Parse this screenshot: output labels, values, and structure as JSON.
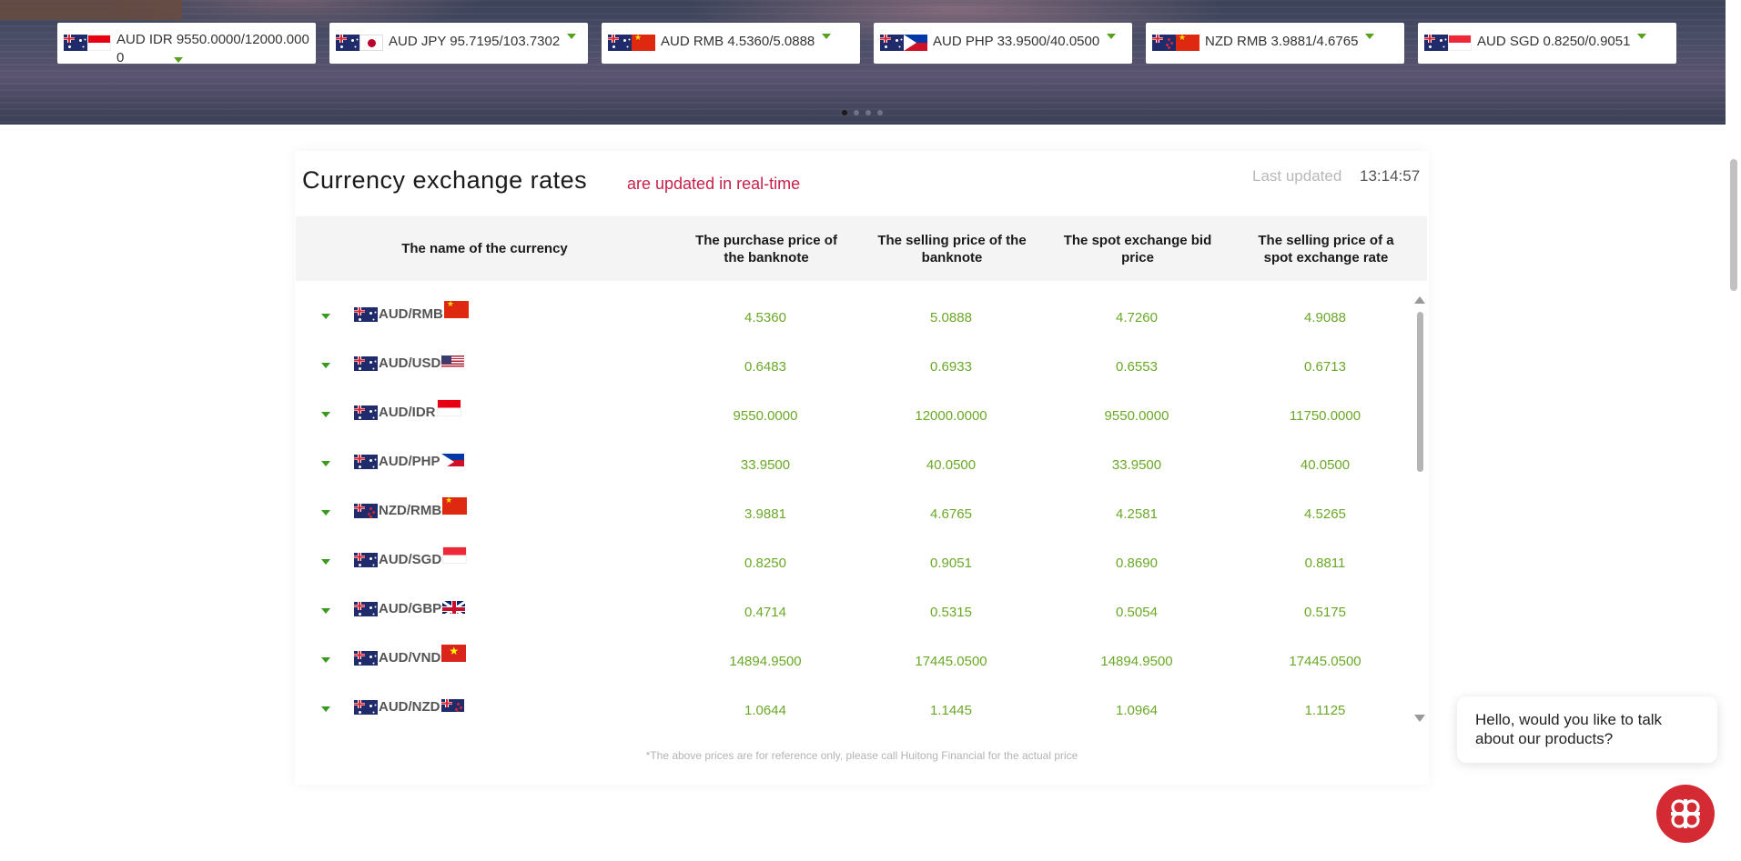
{
  "ticker": [
    {
      "flags": [
        "au",
        "id"
      ],
      "text": "AUD IDR 9550.0000/12000.0000",
      "wrap": true
    },
    {
      "flags": [
        "au",
        "jp"
      ],
      "text": "AUD JPY 95.7195/103.7302",
      "wrap": false
    },
    {
      "flags": [
        "au",
        "cn"
      ],
      "text": "AUD RMB 4.5360/5.0888",
      "wrap": false
    },
    {
      "flags": [
        "au",
        "ph"
      ],
      "text": "AUD PHP 33.9500/40.0500",
      "wrap": false
    },
    {
      "flags": [
        "nz",
        "cn"
      ],
      "text": "NZD RMB 3.9881/4.6765",
      "wrap": false
    },
    {
      "flags": [
        "au",
        "sg"
      ],
      "text": "AUD SGD 0.8250/0.9051",
      "wrap": false
    }
  ],
  "carousel": {
    "slides": 4,
    "active": 0
  },
  "rates": {
    "title": "Currency exchange rates",
    "subtitle": "are updated in real-time",
    "last_updated_label": "Last updated",
    "last_updated_time": "13:14:57",
    "columns": [
      "The name of the currency",
      "The purchase price of the banknote",
      "The selling price of the banknote",
      "The spot exchange bid price",
      "The selling price of a spot exchange rate"
    ],
    "rows": [
      {
        "pair": "AUD/RMB",
        "from": "au",
        "to": "cn",
        "purchase": "4.5360",
        "selling": "5.0888",
        "bid": "4.7260",
        "spot_sell": "4.9088"
      },
      {
        "pair": "AUD/USD",
        "from": "au",
        "to": "us",
        "purchase": "0.6483",
        "selling": "0.6933",
        "bid": "0.6553",
        "spot_sell": "0.6713"
      },
      {
        "pair": "AUD/IDR",
        "from": "au",
        "to": "id",
        "purchase": "9550.0000",
        "selling": "12000.0000",
        "bid": "9550.0000",
        "spot_sell": "11750.0000"
      },
      {
        "pair": "AUD/PHP",
        "from": "au",
        "to": "ph",
        "purchase": "33.9500",
        "selling": "40.0500",
        "bid": "33.9500",
        "spot_sell": "40.0500"
      },
      {
        "pair": "NZD/RMB",
        "from": "nz",
        "to": "cn",
        "purchase": "3.9881",
        "selling": "4.6765",
        "bid": "4.2581",
        "spot_sell": "4.5265"
      },
      {
        "pair": "AUD/SGD",
        "from": "au",
        "to": "sg",
        "purchase": "0.8250",
        "selling": "0.9051",
        "bid": "0.8690",
        "spot_sell": "0.8811"
      },
      {
        "pair": "AUD/GBP",
        "from": "au",
        "to": "gb",
        "purchase": "0.4714",
        "selling": "0.5315",
        "bid": "0.5054",
        "spot_sell": "0.5175"
      },
      {
        "pair": "AUD/VND",
        "from": "au",
        "to": "vn",
        "purchase": "14894.9500",
        "selling": "17445.0500",
        "bid": "14894.9500",
        "spot_sell": "17445.0500"
      },
      {
        "pair": "AUD/NZD",
        "from": "au",
        "to": "nz",
        "purchase": "1.0644",
        "selling": "1.1445",
        "bid": "1.0964",
        "spot_sell": "1.1125"
      }
    ],
    "disclaimer": "*The above prices are for reference only, please call Huitong Financial for the actual price"
  },
  "chat": {
    "message": "Hello, would you like to talk about our products?",
    "icon": "chat-logo-icon",
    "brand_color": "#d42a33"
  },
  "colors": {
    "value_green": "#6aa827",
    "accent_red": "#c8204a",
    "caret_green": "#3a9a1f"
  }
}
